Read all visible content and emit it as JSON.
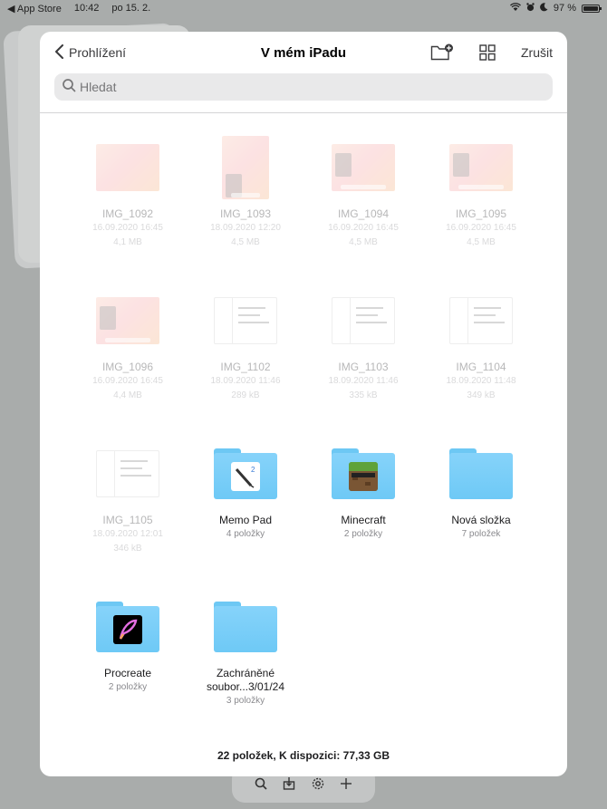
{
  "status_bar": {
    "back_app": "◀ App Store",
    "time": "10:42",
    "date": "po 15. 2.",
    "battery": "97 %",
    "battery_level": 0.97
  },
  "nav": {
    "back_label": "Prohlížení",
    "title": "V mém iPadu",
    "cancel_label": "Zrušit"
  },
  "search": {
    "placeholder": "Hledat"
  },
  "items": [
    {
      "name": "IMG_1092",
      "date": "16.09.2020 16:45",
      "size": "4,1 MB",
      "kind": "image"
    },
    {
      "name": "IMG_1093",
      "date": "18.09.2020 12:20",
      "size": "4,5 MB",
      "kind": "image"
    },
    {
      "name": "IMG_1094",
      "date": "16.09.2020 16:45",
      "size": "4,5 MB",
      "kind": "image"
    },
    {
      "name": "IMG_1095",
      "date": "16.09.2020 16:45",
      "size": "4,5 MB",
      "kind": "image"
    },
    {
      "name": "IMG_1096",
      "date": "16.09.2020 16:45",
      "size": "4,4 MB",
      "kind": "image"
    },
    {
      "name": "IMG_1102",
      "date": "18.09.2020 11:46",
      "size": "289 kB",
      "kind": "image"
    },
    {
      "name": "IMG_1103",
      "date": "18.09.2020 11:46",
      "size": "335 kB",
      "kind": "image"
    },
    {
      "name": "IMG_1104",
      "date": "18.09.2020 11:48",
      "size": "349 kB",
      "kind": "image"
    },
    {
      "name": "IMG_1105",
      "date": "18.09.2020 12:01",
      "size": "346 kB",
      "kind": "image"
    },
    {
      "name": "Memo Pad",
      "count": "4 položky",
      "kind": "folder"
    },
    {
      "name": "Minecraft",
      "count": "2 položky",
      "kind": "folder"
    },
    {
      "name": "Nová složka",
      "count": "7 položek",
      "kind": "folder"
    },
    {
      "name": "Procreate",
      "count": "2 položky",
      "kind": "folder"
    },
    {
      "name": "Zachráněné soubor...3/01/24",
      "count": "3 položky",
      "kind": "folder"
    }
  ],
  "footer": {
    "summary": "22 položek, K dispozici: 77,33 GB"
  },
  "colors": {
    "folder": "#86d3fa",
    "accent": "#3a3a3c"
  }
}
